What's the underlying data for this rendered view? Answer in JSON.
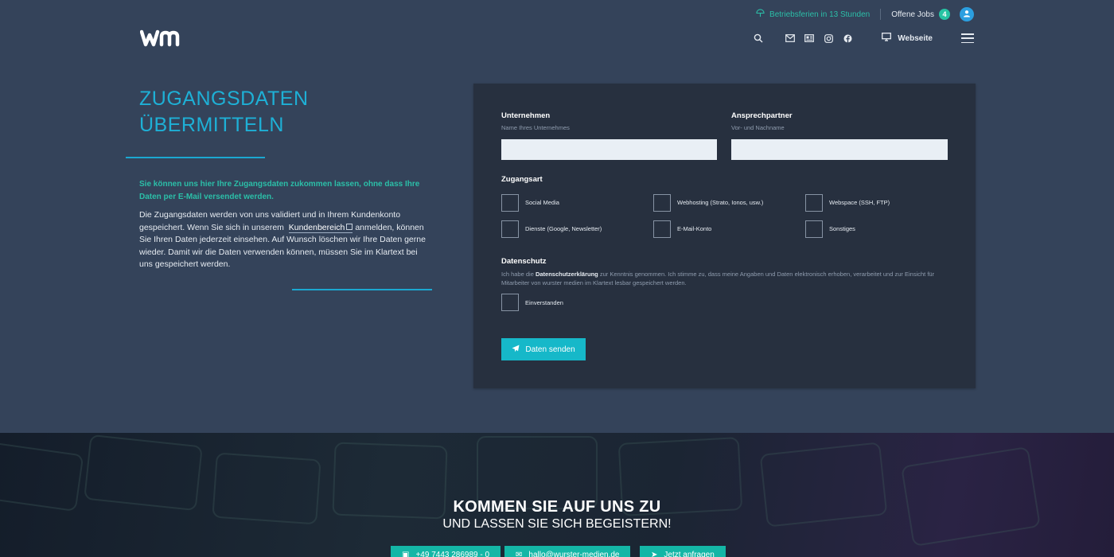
{
  "topbar": {
    "holiday_text": "Betriebsferien in 13 Stunden",
    "jobs_label": "Offene Jobs",
    "jobs_count": "4"
  },
  "header": {
    "website_label": "Webseite",
    "icons": [
      "search-icon",
      "mail-icon",
      "news-icon",
      "instagram-icon",
      "facebook-icon",
      "monitor-icon",
      "menu-icon"
    ]
  },
  "intro": {
    "heading_line1": "ZUGANGSDATEN",
    "heading_line2": "ÜBERMITTELN",
    "lead": "Sie können uns hier Ihre Zugangsdaten zukommen lassen, ohne dass Ihre Daten per E-Mail versendet werden.",
    "body_part1": "Die Zugangsdaten werden von uns validiert und in Ihrem Kundenkonto gespeichert. Wenn Sie sich in unserem",
    "body_link": "Kundenbereich",
    "body_part2": "anmelden, können Sie Ihren Daten jederzeit einsehen. Auf Wunsch löschen wir Ihre Daten gerne wieder. Damit wir die Daten verwenden können, müssen Sie im Klartext bei uns gespeichert werden."
  },
  "form": {
    "company_label": "Unternehmen",
    "company_sub": "Name Ihres Unternehmes",
    "company_value": "",
    "contact_label": "Ansprechpartner",
    "contact_sub": "Vor- und Nachname",
    "contact_value": "",
    "access_label": "Zugangsart",
    "options": [
      "Social Media",
      "Webhosting (Strato, Ionos, usw.)",
      "Webspace (SSH, FTP)",
      "Dienste (Google, Newsletter)",
      "E-Mail-Konto",
      "Sonstiges"
    ],
    "privacy_label": "Datenschutz",
    "privacy_pre": "Ich habe die",
    "privacy_link": "Datenschutzerklärung",
    "privacy_post": "zur Kenntnis genommen. Ich stimme zu, dass meine Angaben und Daten elektronisch erhoben, verarbeitet und zur Einsicht für Mitarbeiter von wurster medien im Klartext lesbar gespeichert werden.",
    "agree_label": "Einverstanden",
    "submit_label": "Daten senden"
  },
  "hero": {
    "title": "KOMMEN SIE AUF UNS ZU",
    "subtitle": "UND LASSEN SIE SICH BEGEISTERN!",
    "btn_phone": "+49 7443 286989 - 0",
    "btn_mail": "hallo@wurster-medien.de",
    "btn_request": "Jetzt anfragen"
  },
  "colors": {
    "background": "#34435a",
    "panel": "#27303f",
    "accent_blue": "#1eb0d6",
    "accent_teal": "#2bbfa8",
    "button": "#16b8c9"
  }
}
